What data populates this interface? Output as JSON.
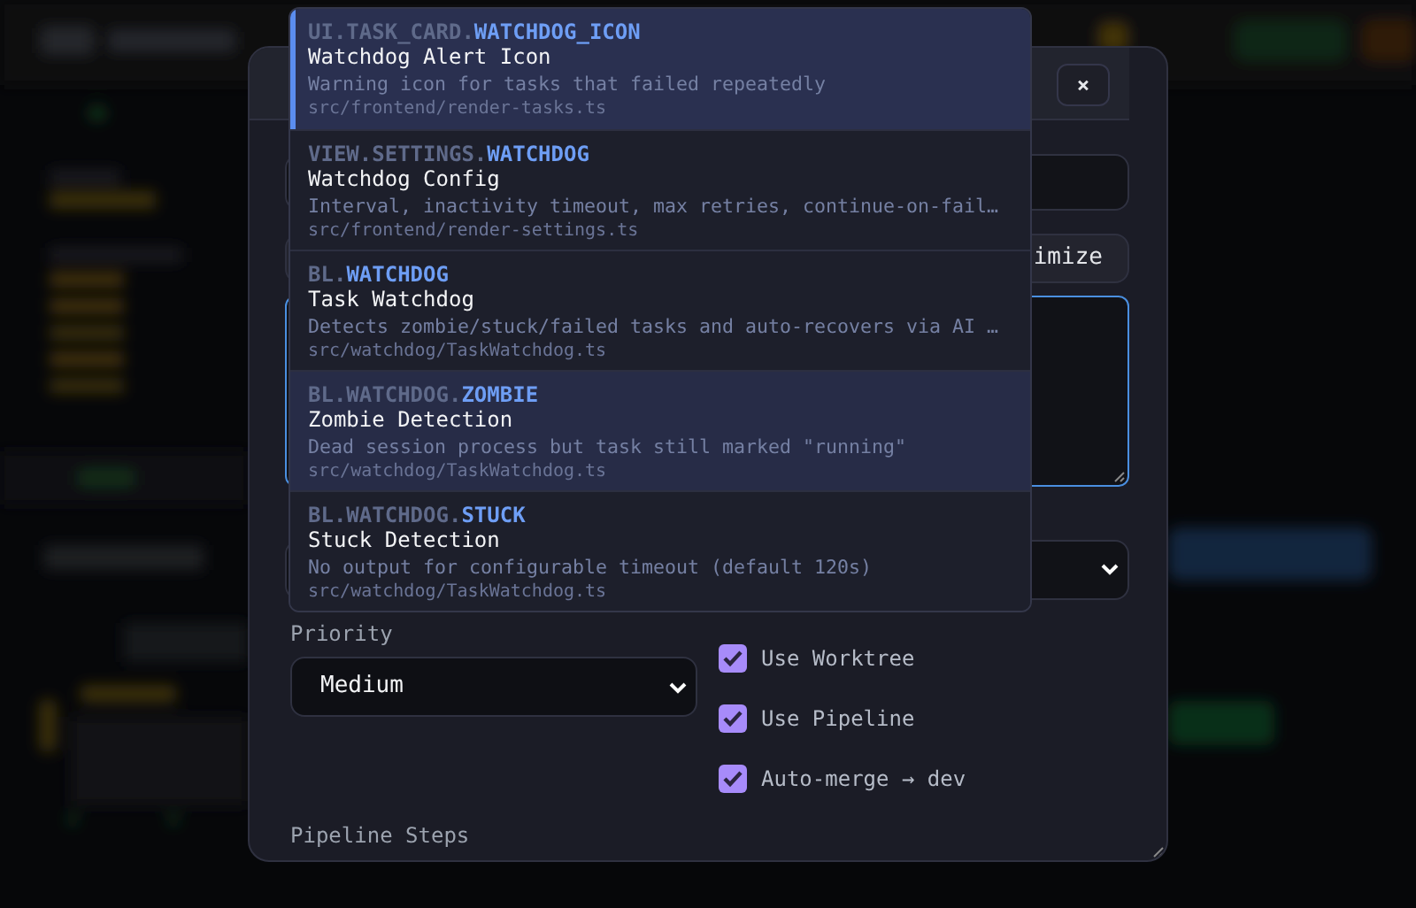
{
  "dialog": {
    "close_label": "×",
    "button_label": "imize",
    "priority_label": "Priority",
    "priority_value": "Medium",
    "pipeline_label": "Pipeline Steps",
    "options": [
      {
        "label": "Use Worktree",
        "checked": true
      },
      {
        "label": "Use Pipeline",
        "checked": true
      },
      {
        "label": "Auto-merge → dev",
        "checked": true
      }
    ]
  },
  "suggestions": [
    {
      "prefix": "UI.TASK_CARD.",
      "key": "WATCHDOG_ICON",
      "title": "Watchdog Alert Icon",
      "description": "Warning icon for tasks that failed repeatedly",
      "path": "src/frontend/render-tasks.ts",
      "selected": true,
      "hovered": false
    },
    {
      "prefix": "VIEW.SETTINGS.",
      "key": "WATCHDOG",
      "title": "Watchdog Config",
      "description": "Interval, inactivity timeout, max retries, continue-on-fail…",
      "path": "src/frontend/render-settings.ts",
      "selected": false,
      "hovered": false
    },
    {
      "prefix": "BL.",
      "key": "WATCHDOG",
      "title": "Task Watchdog",
      "description": "Detects zombie/stuck/failed tasks and auto-recovers via AI …",
      "path": "src/watchdog/TaskWatchdog.ts",
      "selected": false,
      "hovered": false
    },
    {
      "prefix": "BL.WATCHDOG.",
      "key": "ZOMBIE",
      "title": "Zombie Detection",
      "description": "Dead session process but task still marked \"running\"",
      "path": "src/watchdog/TaskWatchdog.ts",
      "selected": false,
      "hovered": true
    },
    {
      "prefix": "BL.WATCHDOG.",
      "key": "STUCK",
      "title": "Stuck Detection",
      "description": "No output for configurable timeout (default 120s)",
      "path": "src/watchdog/TaskWatchdog.ts",
      "selected": false,
      "hovered": false
    }
  ]
}
